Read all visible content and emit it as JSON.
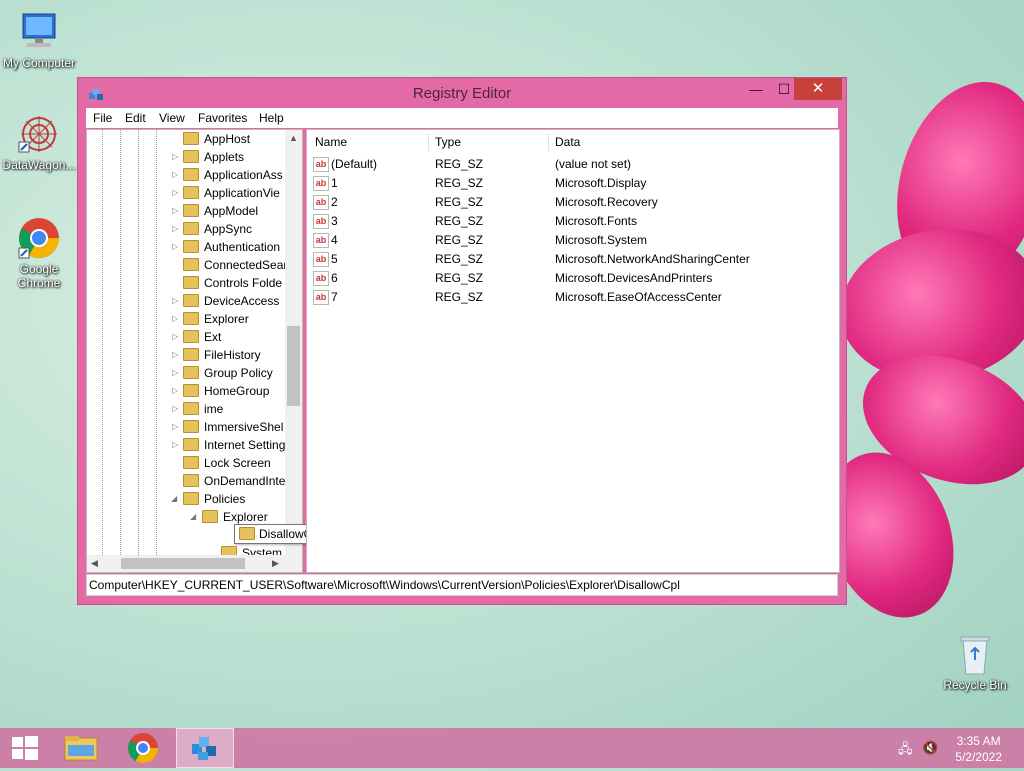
{
  "desktop": {
    "icons": [
      {
        "label": "My Computer"
      },
      {
        "label": "DataWagon..."
      },
      {
        "label": "Google Chrome"
      },
      {
        "label": "Recycle Bin"
      }
    ]
  },
  "window": {
    "title": "Registry Editor",
    "controls": {
      "minimize": "—",
      "maximize": "☐",
      "close": "✕"
    }
  },
  "menu": [
    "File",
    "Edit",
    "View",
    "Favorites",
    "Help"
  ],
  "tree": {
    "items": [
      "AppHost",
      "Applets",
      "ApplicationAss",
      "ApplicationVie",
      "AppModel",
      "AppSync",
      "Authentication",
      "ConnectedSear",
      "Controls Folde",
      "DeviceAccess",
      "Explorer",
      "Ext",
      "FileHistory",
      "Group Policy",
      "HomeGroup",
      "ime",
      "ImmersiveShel",
      "Internet Setting",
      "Lock Screen",
      "OnDemandInte",
      "Policies",
      "Explorer",
      "DisallowCpl",
      "System"
    ]
  },
  "list": {
    "headers": [
      "Name",
      "Type",
      "Data"
    ],
    "rows": [
      {
        "name": "(Default)",
        "type": "REG_SZ",
        "data": "(value not set)"
      },
      {
        "name": "1",
        "type": "REG_SZ",
        "data": "Microsoft.Display"
      },
      {
        "name": "2",
        "type": "REG_SZ",
        "data": "Microsoft.Recovery"
      },
      {
        "name": "3",
        "type": "REG_SZ",
        "data": "Microsoft.Fonts"
      },
      {
        "name": "4",
        "type": "REG_SZ",
        "data": "Microsoft.System"
      },
      {
        "name": "5",
        "type": "REG_SZ",
        "data": "Microsoft.NetworkAndSharingCenter"
      },
      {
        "name": "6",
        "type": "REG_SZ",
        "data": "Microsoft.DevicesAndPrinters"
      },
      {
        "name": "7",
        "type": "REG_SZ",
        "data": "Microsoft.EaseOfAccessCenter"
      }
    ],
    "value_icon": "ab"
  },
  "statusbar": {
    "path": "Computer\\HKEY_CURRENT_USER\\Software\\Microsoft\\Windows\\CurrentVersion\\Policies\\Explorer\\DisallowCpl"
  },
  "tooltip": {
    "text": "DisallowCpl"
  },
  "taskbar": {
    "time": "3:35 AM",
    "date": "5/2/2022"
  },
  "colors": {
    "window_frame": "#e46aa7",
    "close_button": "#c7403a",
    "taskbar": "#cd78a5"
  }
}
